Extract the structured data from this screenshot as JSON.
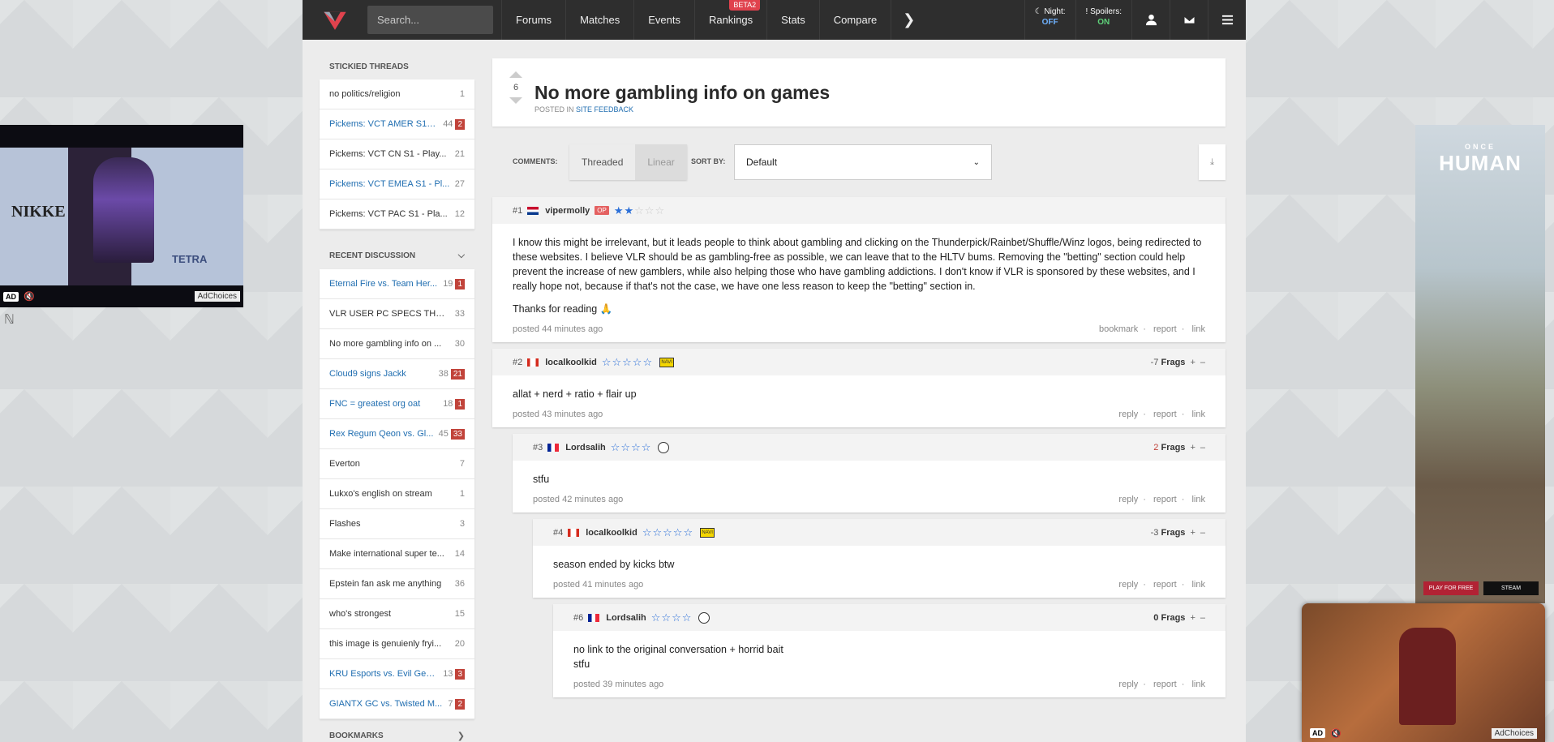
{
  "nav": {
    "search_placeholder": "Search...",
    "items": [
      "Forums",
      "Matches",
      "Events",
      "Rankings",
      "Stats",
      "Compare"
    ],
    "rankings_badge": "BETA2",
    "night_label": "Night:",
    "night_value": "OFF",
    "spoilers_label": "Spoilers:",
    "spoilers_value": "ON"
  },
  "sidebar": {
    "stickied_title": "STICKIED THREADS",
    "stickied": [
      {
        "title": "no politics/religion",
        "count": "1",
        "unread": ""
      },
      {
        "title": "Pickems: VCT AMER S1 -...",
        "count": "44",
        "unread": "2"
      },
      {
        "title": "Pickems: VCT CN S1 - Play...",
        "count": "21",
        "unread": ""
      },
      {
        "title": "Pickems: VCT EMEA S1 - Pl...",
        "count": "27",
        "unread": ""
      },
      {
        "title": "Pickems: VCT PAC S1 - Pla...",
        "count": "12",
        "unread": ""
      }
    ],
    "recent_title": "RECENT DISCUSSION",
    "recent": [
      {
        "title": "Eternal Fire vs. Team Her...",
        "count": "19",
        "unread": "1"
      },
      {
        "title": "VLR USER PC SPECS THRE...",
        "count": "33",
        "unread": ""
      },
      {
        "title": "No more gambling info on ...",
        "count": "30",
        "unread": ""
      },
      {
        "title": "Cloud9 signs Jackk",
        "count": "38",
        "unread": "21"
      },
      {
        "title": "FNC = greatest org oat",
        "count": "18",
        "unread": "1"
      },
      {
        "title": "Rex Regum Qeon vs. Gl...",
        "count": "45",
        "unread": "33"
      },
      {
        "title": "Everton",
        "count": "7",
        "unread": ""
      },
      {
        "title": "Lukxo's english on stream",
        "count": "1",
        "unread": ""
      },
      {
        "title": "Flashes",
        "count": "3",
        "unread": ""
      },
      {
        "title": "Make international super te...",
        "count": "14",
        "unread": ""
      },
      {
        "title": "Epstein fan ask me anything",
        "count": "36",
        "unread": ""
      },
      {
        "title": "who's strongest",
        "count": "15",
        "unread": ""
      },
      {
        "title": "this image is genuienly fryi...",
        "count": "20",
        "unread": ""
      },
      {
        "title": "KRU Esports vs. Evil Gen...",
        "count": "13",
        "unread": "3"
      },
      {
        "title": "GIANTX GC vs. Twisted M...",
        "count": "7",
        "unread": "2"
      }
    ],
    "bookmarks_title": "BOOKMARKS"
  },
  "thread": {
    "votes": "6",
    "title": "No more gambling info on games",
    "posted_in_prefix": "POSTED IN",
    "category": "SITE FEEDBACK",
    "comments_label": "COMMENTS:",
    "mode_threaded": "Threaded",
    "mode_linear": "Linear",
    "sortby_label": "SORT BY:",
    "sort_value": "Default"
  },
  "posts": [
    {
      "num": "#1",
      "author": "vipermolly",
      "op": "OP",
      "paragraphs": [
        "I know this might be irrelevant, but it leads people to think about gambling and clicking on the Thunderpick/Rainbet/Shuffle/Winz logos, being redirected to these websites. I believe VLR should be as gambling-free as possible, we can leave that to the HLTV bums. Removing the \"betting\" section could help prevent the increase of new gamblers, while also helping those who have gambling addictions. I don't know if VLR is sponsored by these websites, and I really hope not, because if that's not the case, we have one less reason to keep the \"betting\" section in.",
        "Thanks for reading 🙏"
      ],
      "time": "posted 44 minutes ago",
      "actions": [
        "bookmark",
        "report",
        "link"
      ]
    },
    {
      "num": "#2",
      "author": "localkoolkid",
      "frags": "-7",
      "paragraphs": [
        "allat + nerd + ratio + flair up"
      ],
      "time": "posted 43 minutes ago",
      "actions": [
        "reply",
        "report",
        "link"
      ]
    },
    {
      "num": "#3",
      "author": "Lordsalih",
      "frags": "2",
      "paragraphs": [
        "stfu"
      ],
      "time": "posted 42 minutes ago",
      "actions": [
        "reply",
        "report",
        "link"
      ]
    },
    {
      "num": "#4",
      "author": "localkoolkid",
      "frags": "-3",
      "paragraphs": [
        "season ended by kicks btw"
      ],
      "time": "posted 41 minutes ago",
      "actions": [
        "reply",
        "report",
        "link"
      ]
    },
    {
      "num": "#6",
      "author": "Lordsalih",
      "frags": "0",
      "paragraphs": [
        "no link to the original conversation + horrid bait",
        "stfu"
      ],
      "time": "posted 39 minutes ago",
      "actions": [
        "reply",
        "report",
        "link"
      ]
    }
  ],
  "frags_label": "Frags",
  "ads": {
    "left_brand": "NIKKE",
    "left_tag": "TETRA",
    "ad_label": "AD",
    "adchoices": "AdChoices",
    "right_brand": "HUMAN",
    "right_brand_top": "ONCE",
    "right_cta_1": "PLAY FOR FREE",
    "right_cta_2": "STEAM"
  }
}
